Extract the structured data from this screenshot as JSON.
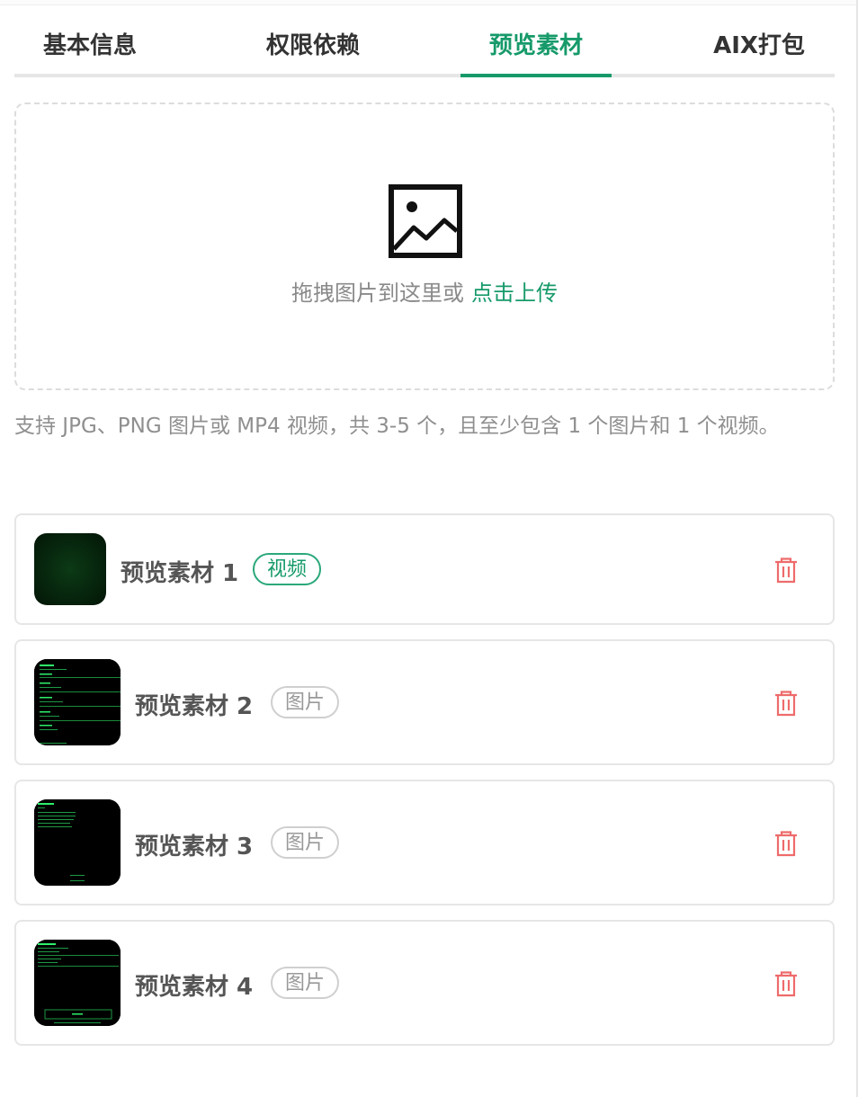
{
  "tabs": [
    {
      "label": "基本信息",
      "active": false
    },
    {
      "label": "权限依赖",
      "active": false
    },
    {
      "label": "预览素材",
      "active": true
    },
    {
      "label": "AIX打包",
      "active": false
    }
  ],
  "upload": {
    "icon": "image-icon",
    "text": "拖拽图片到这里或",
    "link": "点击上传"
  },
  "hint": "支持 JPG、PNG 图片或 MP4 视频，共 3-5 个，且至少包含 1 个图片和 1 个视频。",
  "materials": [
    {
      "title": "预览素材 1",
      "type": "视频"
    },
    {
      "title": "预览素材 2",
      "type": "图片"
    },
    {
      "title": "预览素材 3",
      "type": "图片"
    },
    {
      "title": "预览素材 4",
      "type": "图片"
    }
  ],
  "colors": {
    "accent": "#169a6a",
    "delete": "#ee6b6b",
    "muted": "#8f8f8f"
  },
  "icons": {
    "delete": "trash-icon"
  }
}
